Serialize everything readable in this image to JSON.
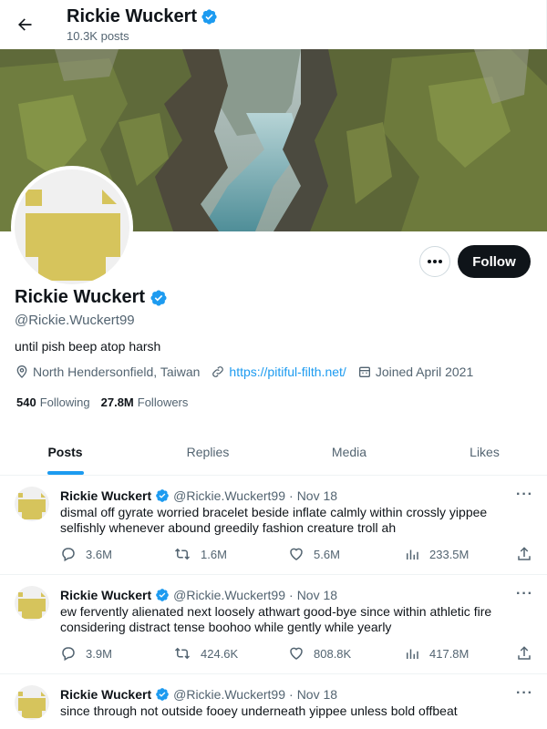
{
  "header": {
    "name": "Rickie Wuckert",
    "posts_count": "10.3K posts"
  },
  "profile": {
    "name": "Rickie Wuckert",
    "handle": "@Rickie.Wuckert99",
    "bio": "until pish beep atop harsh",
    "location": "North Hendersonfield, Taiwan",
    "website": "https://pitiful-filth.net/",
    "joined": "Joined April 2021",
    "following_count": "540",
    "following_label": "Following",
    "followers_count": "27.8M",
    "followers_label": "Followers",
    "follow_label": "Follow",
    "more_label": "···"
  },
  "tabs": [
    {
      "label": "Posts",
      "active": true
    },
    {
      "label": "Replies",
      "active": false
    },
    {
      "label": "Media",
      "active": false
    },
    {
      "label": "Likes",
      "active": false
    }
  ],
  "tweets": [
    {
      "name": "Rickie Wuckert",
      "handle": "@Rickie.Wuckert99",
      "dot": "·",
      "date": "Nov 18",
      "text": "dismal off gyrate worried bracelet beside inflate calmly within crossly yippee selfishly whenever abound greedily fashion creature troll ah",
      "replies": "3.6M",
      "reposts": "1.6M",
      "likes": "5.6M",
      "views": "233.5M"
    },
    {
      "name": "Rickie Wuckert",
      "handle": "@Rickie.Wuckert99",
      "dot": "·",
      "date": "Nov 18",
      "text": "ew fervently alienated next loosely athwart good-bye since within athletic fire considering distract tense boohoo while gently while yearly",
      "replies": "3.9M",
      "reposts": "424.6K",
      "likes": "808.8K",
      "views": "417.8M"
    },
    {
      "name": "Rickie Wuckert",
      "handle": "@Rickie.Wuckert99",
      "dot": "·",
      "date": "Nov 18",
      "text": "since through not outside fooey underneath yippee unless bold offbeat",
      "replies": "",
      "reposts": "",
      "likes": "",
      "views": ""
    }
  ],
  "colors": {
    "accent": "#1d9bf0",
    "avatar_placeholder": "#d6c45c",
    "text_primary": "#0f1419",
    "text_secondary": "#536471"
  },
  "icons": {
    "back": "arrow-left-icon",
    "verified": "verified-badge-icon",
    "location": "location-pin-icon",
    "link": "link-icon",
    "calendar": "calendar-icon",
    "reply": "reply-icon",
    "repost": "repost-icon",
    "like": "heart-icon",
    "views": "views-icon",
    "share": "share-icon"
  }
}
